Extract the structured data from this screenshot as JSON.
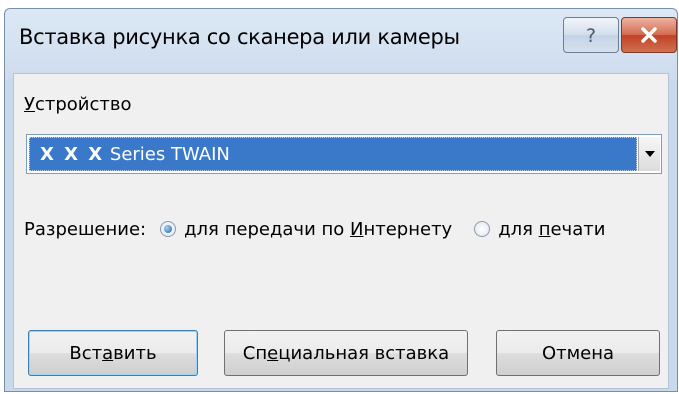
{
  "window": {
    "title": "Вставка рисунка со сканера или камеры",
    "help_symbol": "?",
    "close_symbol": "✕"
  },
  "device": {
    "label_ul": "У",
    "label_rest": "стройство",
    "selected_prefix": "X X X",
    "selected_suffix": " Series TWAIN",
    "dropdown_arrow": "▾"
  },
  "resolution": {
    "label": "Разрешение:",
    "options": [
      {
        "pre": "для передачи по ",
        "ul": "И",
        "post": "нтернету",
        "checked": true
      },
      {
        "pre": "для ",
        "ul": "п",
        "post": "ечати",
        "checked": false
      }
    ]
  },
  "buttons": {
    "insert": {
      "pre": "Вст",
      "ul": "а",
      "post": "вить"
    },
    "special": {
      "pre": "Сп",
      "ul": "е",
      "post": "циальная вставка"
    },
    "cancel": "Отмена"
  },
  "colors": {
    "selection": "#3a78c9",
    "close_button": "#c24127",
    "dialog_frame": "#cddcee"
  }
}
